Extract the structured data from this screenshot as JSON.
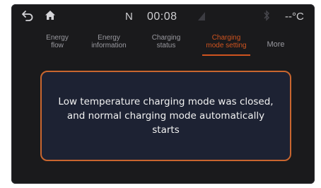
{
  "status_bar": {
    "back_icon": "back-arrow-icon",
    "home_icon": "home-icon",
    "gear": "N",
    "time": "00:08",
    "signal_icon": "signal-icon",
    "bluetooth_icon": "bluetooth-icon",
    "temperature": "--°C"
  },
  "tabs": [
    {
      "label": "Energy\nflow",
      "active": false
    },
    {
      "label": "Energy\ninformation",
      "active": false
    },
    {
      "label": "Charging\nstatus",
      "active": false
    },
    {
      "label": "Charging\nmode setting",
      "active": true
    },
    {
      "label": "More",
      "active": false
    }
  ],
  "dialog": {
    "message": "Low temperature charging mode was closed, and normal charging mode automatically starts"
  },
  "colors": {
    "accent": "#d0541f",
    "dialog_border": "#c9662f",
    "dialog_bg": "#1d2233",
    "screen_bg": "#1a1a1c"
  }
}
